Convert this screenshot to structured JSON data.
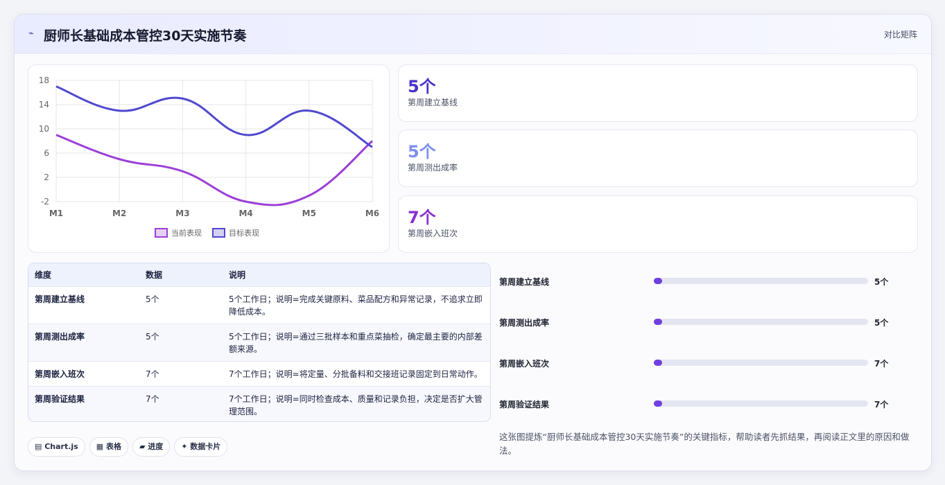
{
  "header": {
    "icon": "pulse-icon",
    "title": "厨师长基础成本管控30天实施节奏",
    "right_label": "对比矩阵"
  },
  "chart_data": {
    "type": "line",
    "categories": [
      "M1",
      "M2",
      "M3",
      "M4",
      "M5",
      "M6"
    ],
    "ylim": [
      -2,
      18
    ],
    "yticks": [
      -2,
      2,
      6,
      10,
      14,
      18
    ],
    "grid": true,
    "legend_position": "bottom",
    "series": [
      {
        "name": "当前表现",
        "color": "#9b3fd6",
        "values": [
          9,
          5,
          3,
          -2,
          -1,
          8
        ]
      },
      {
        "name": "目标表现",
        "color": "#5048cf",
        "values": [
          17,
          13,
          15,
          9,
          13,
          7
        ]
      }
    ]
  },
  "stats": [
    {
      "value": "5个",
      "label": "第周建立基线",
      "color": "#4a33c9"
    },
    {
      "value": "5个",
      "label": "第周测出成率",
      "color": "#7d8ff0"
    },
    {
      "value": "7个",
      "label": "第周嵌入班次",
      "color": "#8a2fd0"
    }
  ],
  "table": {
    "headers": [
      "维度",
      "数据",
      "说明"
    ],
    "rows": [
      [
        "第周建立基线",
        "5个",
        "5个工作日；说明=完成关键原料、菜品配方和异常记录，不追求立即降低成本。"
      ],
      [
        "第周测出成率",
        "5个",
        "5个工作日；说明=通过三批样本和重点菜抽检，确定最主要的内部差额来源。"
      ],
      [
        "第周嵌入班次",
        "7个",
        "7个工作日；说明=将定量、分批备料和交接班记录固定到日常动作。"
      ],
      [
        "第周验证结果",
        "7个",
        "7个工作日；说明=同时检查成本、质量和记录负担，决定是否扩大管理范围。"
      ]
    ]
  },
  "progress": [
    {
      "label": "第周建立基线",
      "value": "5个",
      "fraction": 0.04
    },
    {
      "label": "第周测出成率",
      "value": "5个",
      "fraction": 0.04
    },
    {
      "label": "第周嵌入班次",
      "value": "7个",
      "fraction": 0.04
    },
    {
      "label": "第周验证结果",
      "value": "7个",
      "fraction": 0.04
    }
  ],
  "note": "这张图提炼“厨师长基础成本管控30天实施节奏”的关键指标，帮助读者先抓结果，再阅读正文里的原因和做法。",
  "chips": [
    "▤ Chart.js",
    "▦ 表格",
    "▰ 进度",
    "✦ 数据卡片"
  ]
}
